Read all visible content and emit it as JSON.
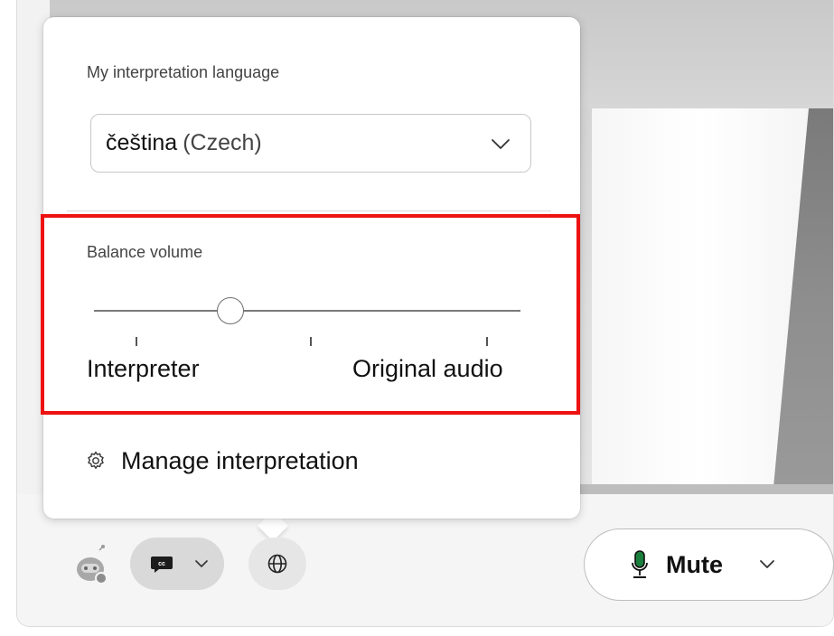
{
  "popup": {
    "language_label": "My interpretation language",
    "language_select": {
      "value_main": "čeština",
      "value_sub": "(Czech)"
    },
    "balance_label": "Balance volume",
    "slider": {
      "left_label": "Interpreter",
      "right_label": "Original audio",
      "position_fraction": 0.32,
      "tick_count": 3
    },
    "manage_label": "Manage interpretation"
  },
  "control_bar": {
    "mute_label": "Mute"
  },
  "colors": {
    "highlight": "#ee1111",
    "mic_accent": "#1a7f3c"
  },
  "icons": [
    "gear-icon",
    "chevron-down-icon",
    "cc-icon",
    "globe-icon",
    "microphone-icon",
    "bot-avatar-icon"
  ]
}
